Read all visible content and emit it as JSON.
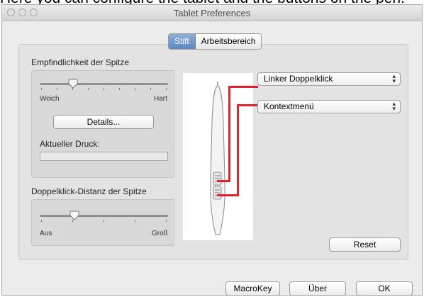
{
  "caption": "Here you can configure the tablet and the buttons on the pen.",
  "window": {
    "title": "Tablet Preferences"
  },
  "tabs": [
    {
      "label": "Stift",
      "selected": true
    },
    {
      "label": "Arbeitsbereich",
      "selected": false
    }
  ],
  "tip_sensitivity": {
    "title": "Empfindlichkeit der Spitze",
    "min_label": "Weich",
    "max_label": "Hart",
    "level": 0.26,
    "details_label": "Details...",
    "pressure_label": "Aktueller Druck:",
    "pressure_level": 0
  },
  "double_click": {
    "title": "Doppelklick-Distanz der Spitze",
    "min_label": "Aus",
    "max_label": "Groß",
    "level": 0.27
  },
  "pen_buttons": {
    "upper": "Linker Doppelklick",
    "lower": "Kontextmenü"
  },
  "reset_label": "Reset",
  "footer": {
    "macrokey": "MacroKey",
    "about": "Über",
    "ok": "OK"
  },
  "colors": {
    "accent": "#5b88c6",
    "callout": "#e4222b"
  }
}
